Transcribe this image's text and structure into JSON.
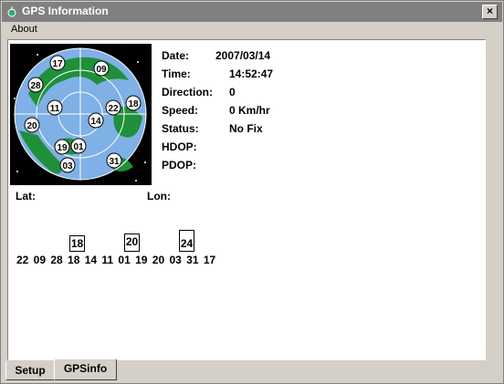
{
  "window": {
    "title": "GPS Information",
    "close_label": "×"
  },
  "menu": {
    "about": "About"
  },
  "info": {
    "date_label": "Date:",
    "date_value": "2007/03/14",
    "time_label": "Time:",
    "time_value": "14:52:47",
    "direction_label": "Direction:",
    "direction_value": "0",
    "speed_label": "Speed:",
    "speed_value": "0 Km/hr",
    "status_label": "Status:",
    "status_value": "No Fix",
    "hdop_label": "HDOP:",
    "hdop_value": "",
    "pdop_label": "PDOP:",
    "pdop_value": ""
  },
  "position": {
    "lat_label": "Lat:",
    "lon_label": "Lon:"
  },
  "skyplot": {
    "satellites": [
      "17",
      "09",
      "28",
      "11",
      "18",
      "22",
      "20",
      "14",
      "19",
      "01",
      "03",
      "31"
    ]
  },
  "snr": {
    "boxes": [
      "18",
      "20",
      "24"
    ],
    "sat_ids_line": "22 09 28 18 14 11 01 19 20 03 31 17"
  },
  "tabs": {
    "setup": "Setup",
    "gpsinfo": "GPSinfo"
  },
  "colors": {
    "title_bar": "#808080",
    "globe_ocean": "#7fb0e6",
    "globe_land": "#1f8f3a",
    "space": "#000000"
  }
}
